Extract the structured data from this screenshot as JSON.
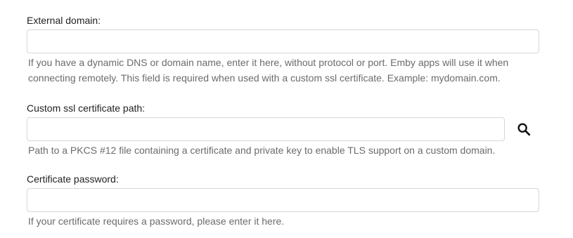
{
  "fields": {
    "external_domain": {
      "label": "External domain:",
      "value": "",
      "placeholder": "",
      "help": "If you have a dynamic DNS or domain name, enter it here, without protocol or port. Emby apps will use it when connecting remotely. This field is required when used with a custom ssl certificate. Example: mydomain.com."
    },
    "ssl_certificate_path": {
      "label": "Custom ssl certificate path:",
      "value": "",
      "placeholder": "",
      "help": "Path to a PKCS #12 file containing a certificate and private key to enable TLS support on a custom domain.",
      "browse_icon": "search-icon"
    },
    "certificate_password": {
      "label": "Certificate password:",
      "value": "",
      "placeholder": "",
      "help": "If your certificate requires a password, please enter it here."
    }
  }
}
